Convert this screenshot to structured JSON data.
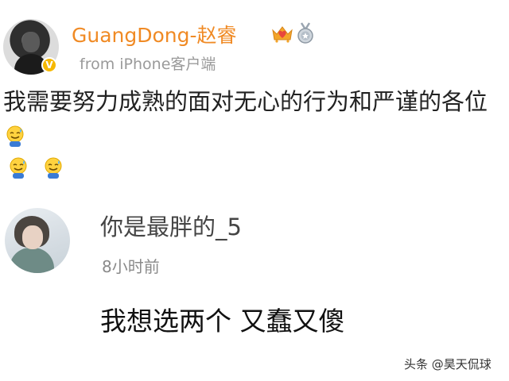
{
  "post": {
    "username": "GuangDong-赵睿",
    "verified_badge": "V",
    "source": "from iPhone客户端",
    "text": "我需要努力成熟的面对无心的行为和严谨的各位",
    "inline_emoji": "sweat-smile-emoji",
    "trailing_emojis": [
      "sweat-smile-emoji",
      "sweat-smile-emoji"
    ],
    "icons": [
      "crown-heart-icon",
      "medal-icon"
    ],
    "brand_color": "#f08a24"
  },
  "comment": {
    "username": "你是最胖的_5",
    "time": "8小时前",
    "text": "我想选两个 又蠢又傻"
  },
  "watermark": {
    "text": "头条 @昊天侃球"
  }
}
